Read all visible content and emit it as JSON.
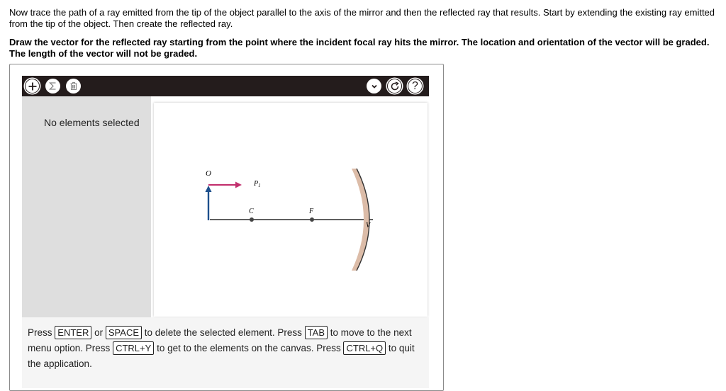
{
  "instructions": {
    "paragraph1": "Now trace the path of a ray emitted from the tip of the object parallel to the axis of the mirror and then the reflected ray that results. Start by extending the existing ray emitted from the tip of the object. Then create the reflected ray.",
    "paragraph2": "Draw the vector for the reflected ray starting from the point where the incident focal ray hits the mirror. The location and orientation of the vector will be graded. The length of the vector will not be graded."
  },
  "toolbar": {
    "add_icon": "plus-icon",
    "sum_icon": "sigma-icon",
    "trash_icon": "trash-icon",
    "dropdown_icon": "chevron-down-icon",
    "reset_icon": "reset-icon",
    "help_label": "?"
  },
  "sidebar": {
    "selection_label": "No elements selected"
  },
  "diagram": {
    "object_label": "O",
    "ray_label": "P",
    "ray_subscript": "1",
    "center_label": "C",
    "focal_label": "F",
    "vertex_label": "V",
    "colors": {
      "object_arrow": "#1d4f8c",
      "ray_vector": "#c2306e",
      "mirror_fill": "#dcbca8",
      "axis": "#000000"
    }
  },
  "help": {
    "t1": "Press",
    "k1": "ENTER",
    "t2": "or",
    "k2": "SPACE",
    "t3": "to delete the selected element. Press",
    "k3": "TAB",
    "t4": "to move to the next menu option. Press",
    "k4": "CTRL+Y",
    "t5": "to get to the elements on the canvas. Press",
    "k5": "CTRL+Q",
    "t6": "to quit the application."
  }
}
